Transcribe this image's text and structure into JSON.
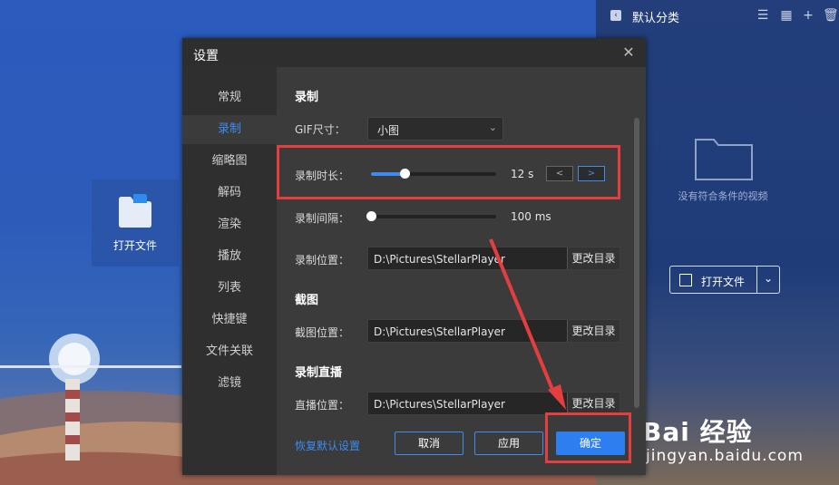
{
  "desktop": {
    "tile_label": "打开文件"
  },
  "right_panel": {
    "title": "默认分类",
    "empty_text": "没有符合条件的视频",
    "open_button_label": "打开文件"
  },
  "dialog": {
    "title": "设置",
    "nav": [
      "常规",
      "录制",
      "缩略图",
      "解码",
      "渲染",
      "播放",
      "列表",
      "快捷键",
      "文件关联",
      "滤镜"
    ],
    "active_nav": "录制",
    "sections": {
      "record_title": "录制",
      "gif_label": "GIF尺寸：",
      "gif_value": "小图",
      "duration_label": "录制时长：",
      "duration_value": "12 s",
      "duration_fraction": 0.27,
      "interval_label": "录制间隔：",
      "interval_value": "100 ms",
      "interval_fraction": 0.0,
      "location_label": "录制位置：",
      "location_path": "D:\\Pictures\\StellarPlayer",
      "change_dir": "更改目录",
      "screenshot_title": "截图",
      "screenshot_label": "截图位置：",
      "screenshot_path": "D:\\Pictures\\StellarPlayer",
      "live_title": "录制直播",
      "live_label": "直播位置：",
      "live_path": "D:\\Pictures\\StellarPlayer"
    },
    "footer": {
      "restore": "恢复默认设置",
      "cancel": "取消",
      "apply": "应用",
      "ok": "确定"
    }
  },
  "watermark": {
    "brand": "Bai 经验",
    "url": "jingyan.baidu.com"
  },
  "colors": {
    "accent": "#3d8cf0",
    "highlight": "#e53e3e"
  }
}
